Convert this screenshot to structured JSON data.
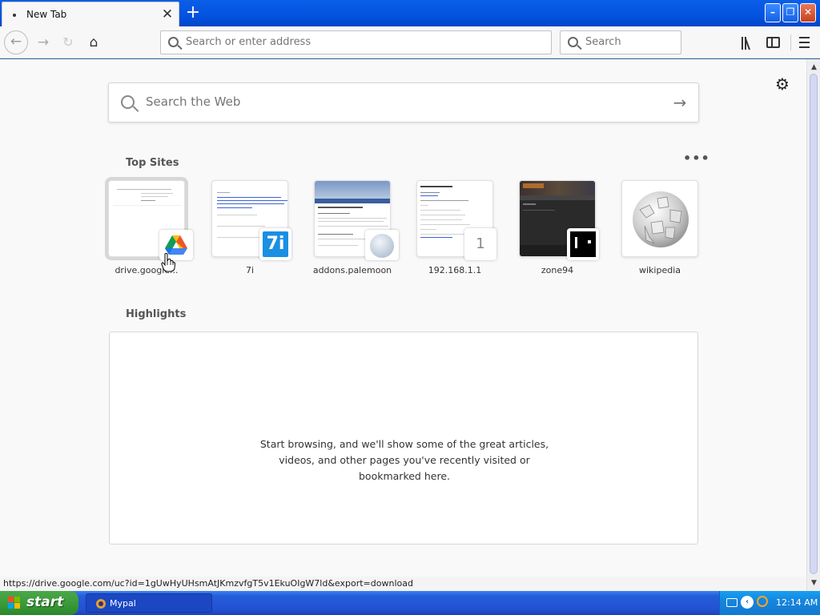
{
  "window": {
    "tab_title": "New Tab",
    "tab_close_glyph": "✕",
    "new_tab_glyph": "+",
    "controls": {
      "minimize": "–",
      "maximize": "❐",
      "close": "✕"
    }
  },
  "toolbar": {
    "back_glyph": "←",
    "forward_glyph": "→",
    "reload_glyph": "↻",
    "home_glyph": "⌂",
    "address_placeholder": "Search or enter address",
    "address_value": "",
    "search_placeholder": "Search",
    "icons": [
      "back-icon",
      "forward-icon",
      "reload-icon",
      "home-icon",
      "library-icon",
      "sidebar-icon",
      "hamburger-menu-icon"
    ]
  },
  "newtab": {
    "settings_glyph": "⚙",
    "websearch_placeholder": "Search the Web",
    "websearch_go_glyph": "→",
    "topsites_title": "Top Sites",
    "topsites_more_glyph": "•••",
    "highlights_title": "Highlights",
    "highlights_empty": "Start browsing, and we'll show some of the great articles, videos, and other pages you've recently visited or bookmarked here.",
    "top_sites": [
      {
        "label": "drive.google...",
        "icon": "google-drive-icon"
      },
      {
        "label": "7i",
        "icon": "7i-icon",
        "badge_text": "7i"
      },
      {
        "label": "addons.palemoon",
        "icon": "palemoon-icon"
      },
      {
        "label": "192.168.1.1",
        "icon": "number-badge",
        "badge_text": "1"
      },
      {
        "label": "zone94",
        "icon": "zone94-icon"
      },
      {
        "label": "wikipedia",
        "icon": "wikipedia-globe-icon"
      }
    ]
  },
  "status_bar": {
    "text": "https://drive.google.com/uc?id=1gUwHyUHsmAtJKmzvfgT5v1EkuOIgW7ld&export=download"
  },
  "taskbar": {
    "start_label": "start",
    "task_label": "Mypal",
    "clock": "12:14 AM"
  },
  "colors": {
    "accent": "#0a5ee8",
    "content_bg": "#f9f9fa",
    "start_green": "#3b9b3b"
  }
}
